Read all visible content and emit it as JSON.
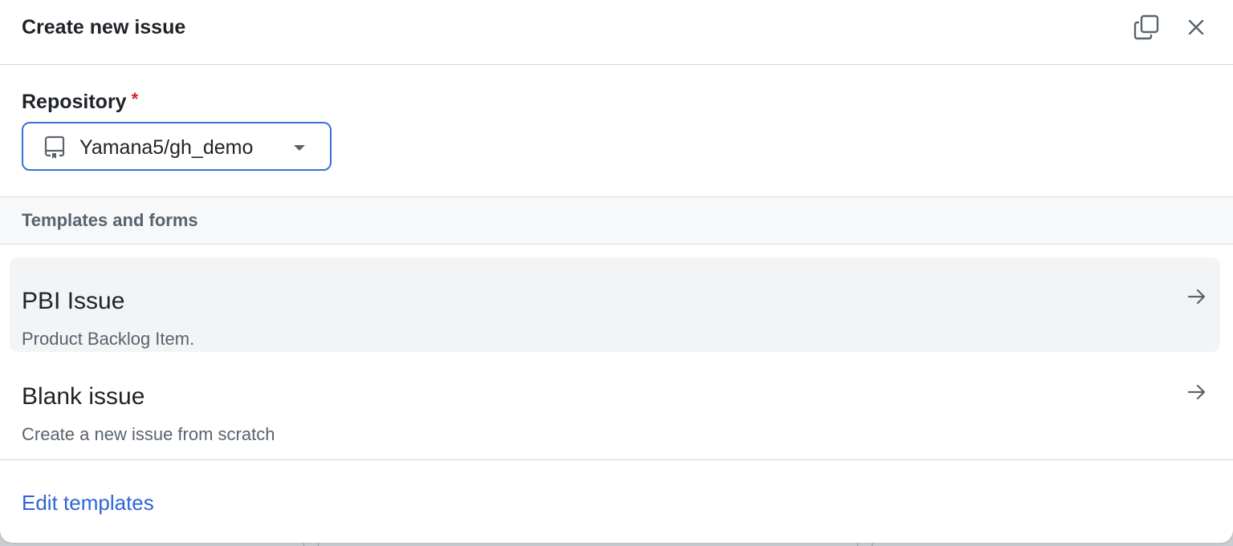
{
  "dialog": {
    "title": "Create new issue",
    "copy_icon": "duplicate-icon",
    "close_icon": "x-icon"
  },
  "repository": {
    "label": "Repository",
    "required_marker": "*",
    "selected_value": "Yamana5/gh_demo",
    "icon": "repo-icon",
    "focus_color": "#3a6fd8"
  },
  "templates": {
    "section_label": "Templates and forms",
    "items": [
      {
        "name": "PBI Issue",
        "description": "Product Backlog Item.",
        "icon": "arrow-right-icon"
      },
      {
        "name": "Blank issue",
        "description": "Create a new issue from scratch",
        "icon": "arrow-right-icon"
      }
    ]
  },
  "footer": {
    "edit_templates_label": "Edit templates",
    "link_color": "#2f64d6"
  }
}
